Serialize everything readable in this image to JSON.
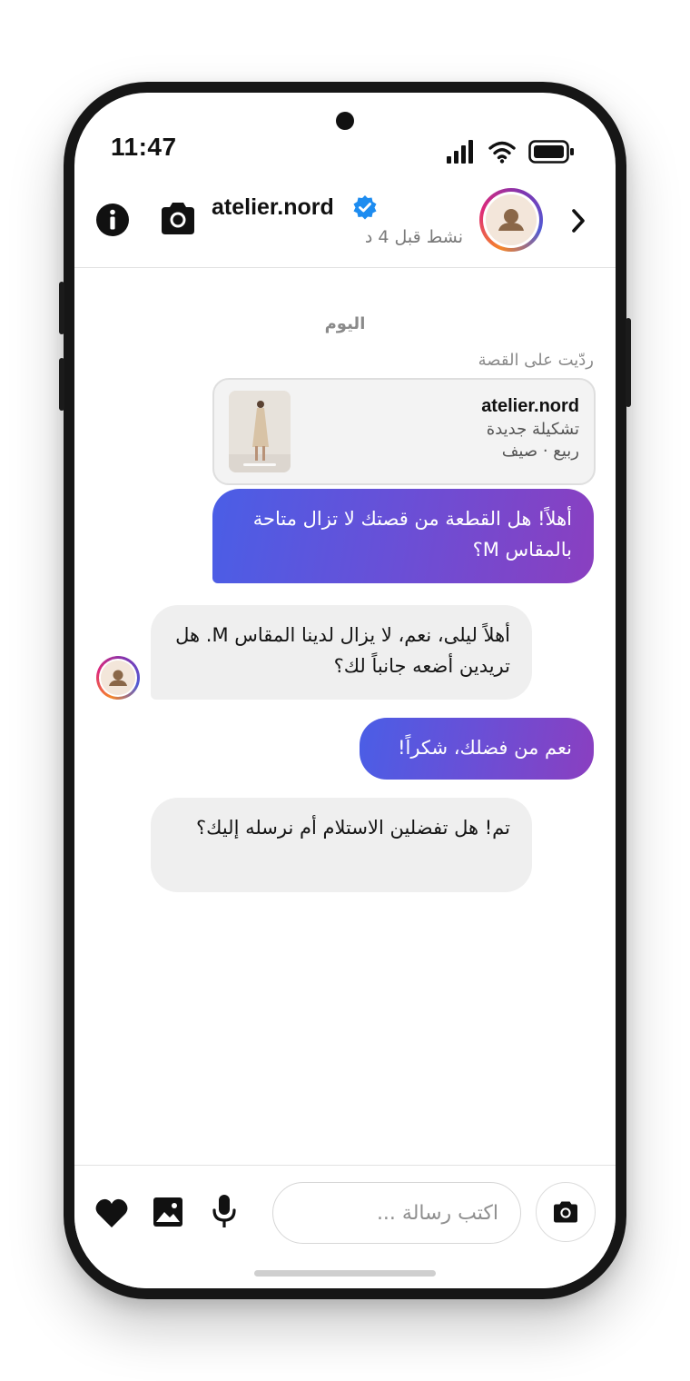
{
  "status_bar": {
    "time": "11:47",
    "icons": [
      "signal-icon",
      "wifi-icon",
      "battery-icon"
    ]
  },
  "header": {
    "username": "atelier.nord",
    "verified": true,
    "active_status": "نشط قبل 4 د",
    "icons": [
      "info-icon",
      "camera-icon",
      "back-chevron-icon"
    ]
  },
  "chat": {
    "day_separator": "اليوم",
    "story_reply": {
      "label": "ردّيت على القصة",
      "story_user": "atelier.nord",
      "story_line1": "تشكيلة جديدة",
      "story_line2": "ربيع · صيف"
    },
    "messages": [
      {
        "direction": "outgoing",
        "text": "أهلاً! هل القطعة من قصتك لا تزال متاحة بالمقاس M؟"
      },
      {
        "direction": "incoming",
        "text": "أهلاً ليلى، نعم، لا يزال لدينا المقاس M. هل تريدين أضعه جانباً لك؟"
      },
      {
        "direction": "outgoing",
        "text": "نعم من فضلك، شكراً!"
      },
      {
        "direction": "incoming",
        "text": "تم! هل تفضلين الاستلام أم نرسله إليك؟"
      }
    ]
  },
  "composer": {
    "placeholder": "اكتب رسالة ...",
    "value": "",
    "icons": [
      "camera-icon",
      "microphone-icon",
      "image-icon",
      "heart-icon"
    ]
  },
  "colors": {
    "accent_gradient_start": "#4a5ee6",
    "accent_gradient_end": "#8a3fc0",
    "verified_blue": "#1d8cf0",
    "incoming_bubble": "#efefef"
  }
}
